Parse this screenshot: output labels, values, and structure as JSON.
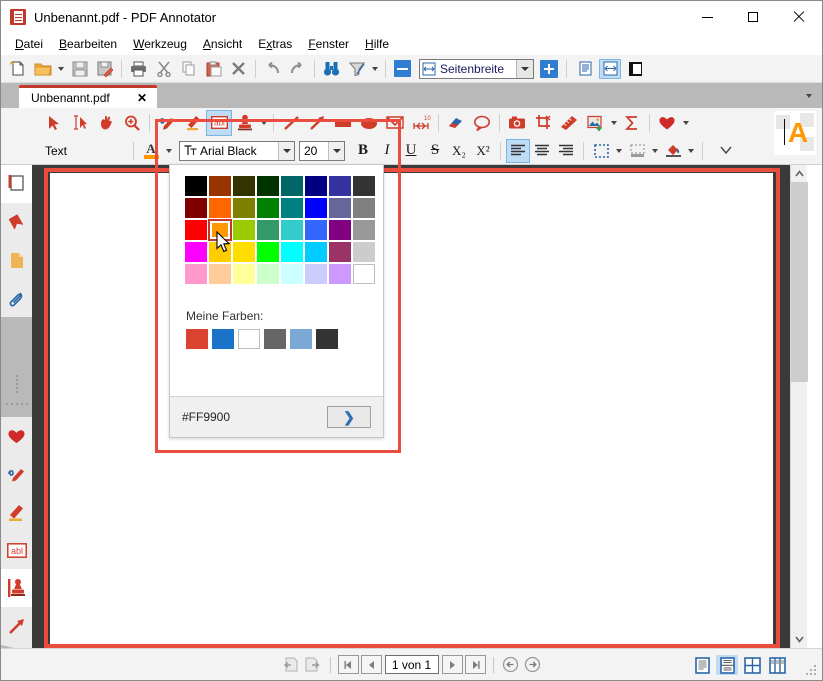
{
  "window": {
    "title": "Unbenannt.pdf - PDF Annotator",
    "app_icon": "pdf-annotator-icon",
    "minimize": "—",
    "maximize": "□",
    "close": "✕"
  },
  "menubar": {
    "items": [
      {
        "label": "Datei",
        "accel": "D"
      },
      {
        "label": "Bearbeiten",
        "accel": "B"
      },
      {
        "label": "Werkzeug",
        "accel": "W"
      },
      {
        "label": "Ansicht",
        "accel": "A"
      },
      {
        "label": "Extras",
        "accel": "x"
      },
      {
        "label": "Fenster",
        "accel": "F"
      },
      {
        "label": "Hilfe",
        "accel": "H"
      }
    ]
  },
  "main_toolbar": {
    "buttons": [
      {
        "name": "new-document-icon",
        "title": "Neu"
      },
      {
        "name": "open-folder-icon",
        "title": "Öffnen"
      },
      {
        "name": "open-dropdown-icon",
        "title": "Öffnen Optionen"
      },
      {
        "name": "save-icon",
        "title": "Speichern"
      },
      {
        "name": "save-as-icon",
        "title": "Speichern unter"
      },
      {
        "name": "print-icon",
        "title": "Drucken"
      },
      {
        "name": "cut-icon",
        "title": "Ausschneiden"
      },
      {
        "name": "copy-icon",
        "title": "Kopieren"
      },
      {
        "name": "paste-icon",
        "title": "Einfügen"
      },
      {
        "name": "delete-icon",
        "title": "Löschen"
      },
      {
        "name": "undo-icon",
        "title": "Rückgängig"
      },
      {
        "name": "redo-icon",
        "title": "Wiederherstellen"
      },
      {
        "name": "find-binoculars-icon",
        "title": "Suchen"
      },
      {
        "name": "filter-icon",
        "title": "Filter"
      },
      {
        "name": "zoom-out-icon",
        "title": "Verkleinern"
      }
    ],
    "zoom_value": "Seitenbreite",
    "zoom_icon": "fit-page-width-icon",
    "zoom_in": "zoom-in-plus-button",
    "page_modes": [
      {
        "name": "single-page-view-icon",
        "selected": false
      },
      {
        "name": "fit-width-view-icon",
        "selected": true
      },
      {
        "name": "sidebar-toggle-icon",
        "selected": false
      }
    ]
  },
  "tabbar": {
    "tab_label": "Unbenannt.pdf",
    "tab_close": "✕",
    "overflow": "tab-overflow-menu"
  },
  "annot_toolbar": {
    "tools": [
      {
        "name": "select-arrow-tool",
        "selected": false
      },
      {
        "name": "text-select-tool",
        "selected": false
      },
      {
        "name": "hand-pan-tool",
        "selected": false
      },
      {
        "name": "zoom-magnifier-tool",
        "selected": false
      },
      {
        "name": "squiggle-pen-tool",
        "selected": false
      },
      {
        "name": "highlighter-tool",
        "selected": false
      },
      {
        "name": "text-box-tool",
        "selected": true
      },
      {
        "name": "stamp-tool",
        "selected": false
      },
      {
        "name": "stamp-dropdown",
        "selected": false
      },
      {
        "name": "line-tool",
        "selected": false
      },
      {
        "name": "arrow-tool",
        "selected": false
      },
      {
        "name": "rectangle-tool",
        "selected": false
      },
      {
        "name": "ellipse-tool",
        "selected": false
      },
      {
        "name": "polygon-tool",
        "selected": false
      },
      {
        "name": "measure-tool",
        "selected": false
      },
      {
        "name": "eraser-tool",
        "selected": false
      },
      {
        "name": "comment-bubble-tool",
        "selected": false
      },
      {
        "name": "snapshot-camera-tool",
        "selected": false
      },
      {
        "name": "crop-tool",
        "selected": false
      },
      {
        "name": "ruler-tool",
        "selected": false
      },
      {
        "name": "insert-image-tool",
        "selected": false
      },
      {
        "name": "insert-image-dropdown",
        "selected": false
      },
      {
        "name": "formula-sigma-tool",
        "selected": false
      },
      {
        "name": "favorites-heart-tool",
        "selected": false
      },
      {
        "name": "favorites-dropdown",
        "selected": false
      }
    ]
  },
  "text_toolbar": {
    "group_label": "Text",
    "font_color_icon": "font-color-icon",
    "font_color_value": "#FF9900",
    "font_color_dropdown": "font-color-dropdown",
    "font_icon": "font-family-icon",
    "font_family": "Arial Black",
    "font_size": "20",
    "bold": "B",
    "italic": "I",
    "underline": "U",
    "strikethrough": "S",
    "subscript": "X₂",
    "superscript": "X²",
    "align_left": "align-left-icon",
    "align_center": "align-center-icon",
    "align_right": "align-right-icon",
    "align_selected": "align-left-icon",
    "border_style_icon": "border-style-icon",
    "border_dropdown": "border-style-dropdown",
    "fill_underline_icon": "cell-fill-icon",
    "fill_dropdown": "cell-fill-dropdown",
    "bucket_fill_icon": "paint-bucket-icon",
    "bucket_dropdown": "paint-bucket-dropdown",
    "overflow_chevron": "toolbar-overflow-chevron"
  },
  "left_strip": {
    "items": [
      {
        "name": "page-thumbnail-tool",
        "selected": true
      },
      {
        "name": "bookmark-ribbon-tool",
        "selected": false
      },
      {
        "name": "notes-page-tool",
        "selected": false
      },
      {
        "name": "attachment-clip-tool",
        "selected": false
      },
      {
        "name": "favorites-heart-tool",
        "selected": false
      },
      {
        "name": "pen-squiggle-tool",
        "selected": false
      },
      {
        "name": "highlighter-pen-tool",
        "selected": false
      },
      {
        "name": "text-box-abl-tool",
        "selected": false
      },
      {
        "name": "stamp-tool",
        "selected": true
      },
      {
        "name": "arrow-tool",
        "selected": false
      }
    ]
  },
  "color_popup": {
    "palette": [
      [
        "#000000",
        "#993300",
        "#333300",
        "#003300",
        "#006666",
        "#000080",
        "#3333A0",
        "#333333"
      ],
      [
        "#800000",
        "#FF6600",
        "#808000",
        "#008000",
        "#008080",
        "#0000FF",
        "#666699",
        "#808080"
      ],
      [
        "#FF0000",
        "#FF9900",
        "#99CC00",
        "#339966",
        "#33CCCC",
        "#3366FF",
        "#800080",
        "#999999"
      ],
      [
        "#FF00FF",
        "#FFCC00",
        "#FFDD00",
        "#00FF00",
        "#00FFFF",
        "#00CCFF",
        "#993366",
        "#CCCCCC"
      ],
      [
        "#FF99CC",
        "#FFCC99",
        "#FFFF99",
        "#CCFFCC",
        "#CCFFFF",
        "#CCCCFF",
        "#CC99FF",
        "#FFFFFF"
      ]
    ],
    "selected_row": 2,
    "selected_col": 1,
    "selected_color": "#FF9900",
    "my_colors_label": "Meine Farben:",
    "my_colors": [
      "#D9432F",
      "#1A73C8",
      "#FFFFFF",
      "#666666",
      "#7CA8D6",
      "#333333"
    ],
    "hex_value": "#FF9900",
    "apply_button": "❯"
  },
  "statusbar": {
    "buttons": [
      {
        "name": "previous-view-icon"
      },
      {
        "name": "next-view-icon"
      }
    ],
    "nav": {
      "first": "◀|",
      "prev": "◀",
      "page_value": "1 von 1",
      "next": "▶",
      "last": "|▶"
    },
    "back": "back-circle-icon",
    "forward": "forward-circle-icon",
    "view_modes": [
      {
        "name": "single-page-layout-icon",
        "selected": false
      },
      {
        "name": "continuous-layout-icon",
        "selected": true
      },
      {
        "name": "two-page-layout-icon",
        "selected": false
      },
      {
        "name": "two-page-continuous-layout-icon",
        "selected": false
      }
    ],
    "resize_grip": "resize-grip"
  },
  "right_panel": {
    "badge_letter": "A",
    "badge_color": "#FF9900"
  },
  "scrollbar": {
    "up_arrow": "▲",
    "down_arrow": "▼"
  }
}
